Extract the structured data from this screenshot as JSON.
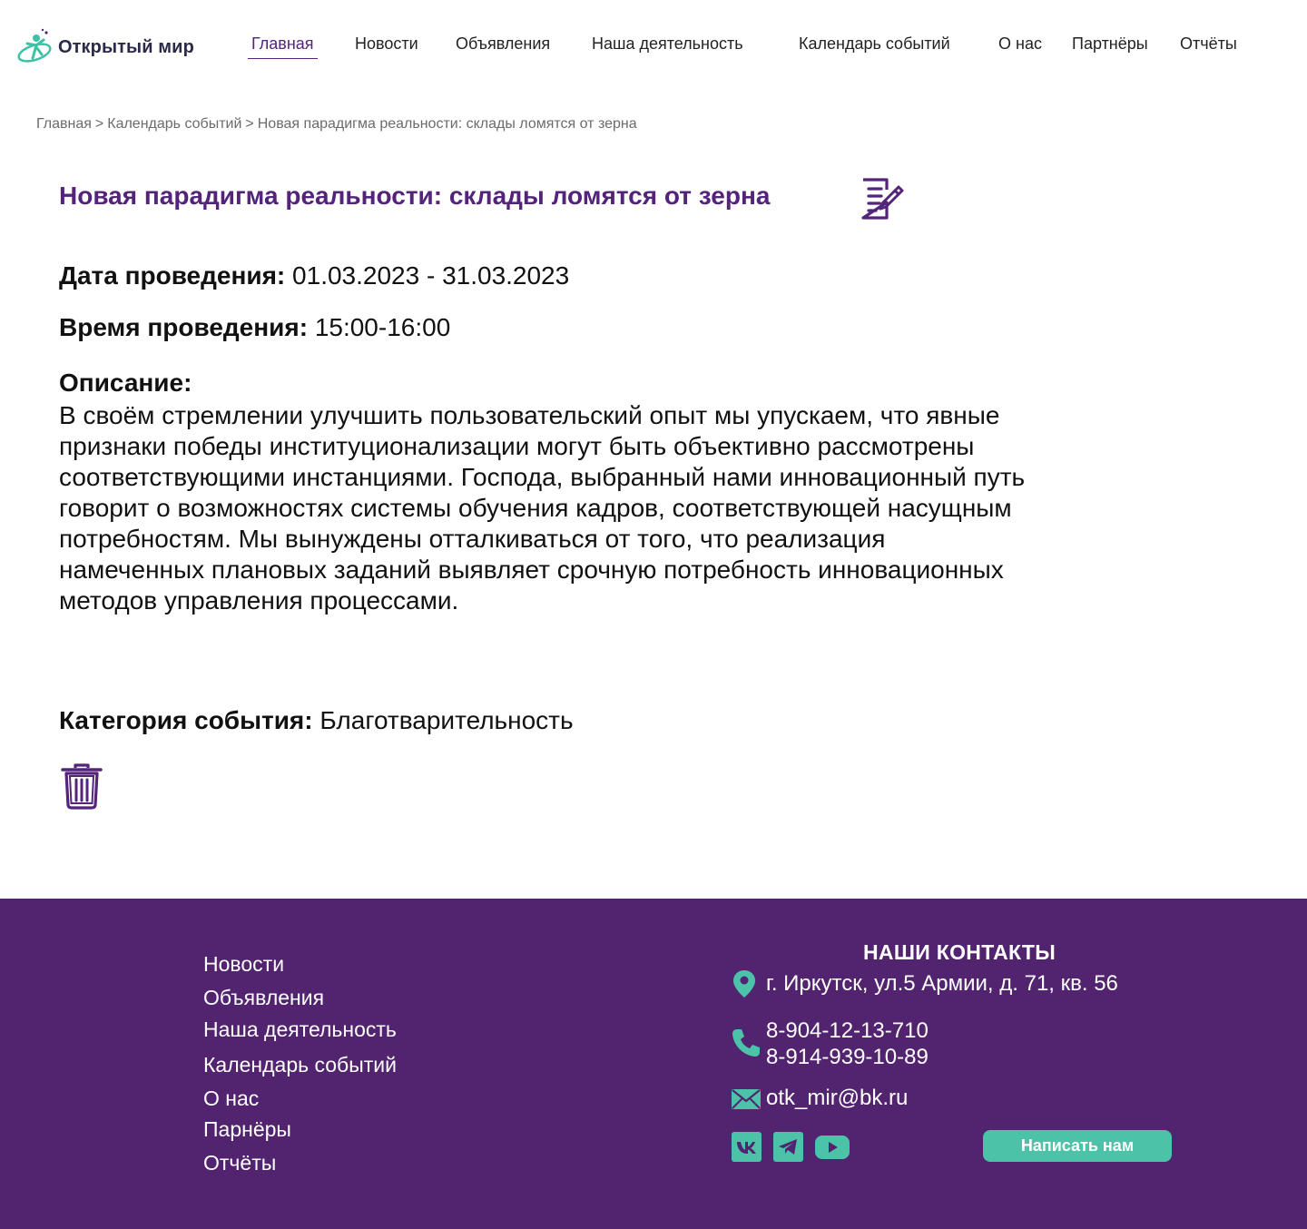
{
  "header": {
    "logo_text": "Открытый мир",
    "nav": [
      {
        "label": "Главная",
        "active": true
      },
      {
        "label": "Новости"
      },
      {
        "label": "Объявления"
      },
      {
        "label": "Наша деятельность"
      },
      {
        "label": "Календарь событий"
      },
      {
        "label": "О нас"
      },
      {
        "label": "Партнёры"
      },
      {
        "label": "Отчёты"
      }
    ]
  },
  "breadcrumb": {
    "items": [
      "Главная",
      "Календарь событий",
      "Новая парадигма реальности: склады ломятся от зерна"
    ],
    "separator": ">"
  },
  "event": {
    "title": "Новая парадигма реальности: склады ломятся от зерна",
    "date_label": "Дата проведения:",
    "date_value": "01.03.2023 - 31.03.2023",
    "time_label": "Время проведения:",
    "time_value": "15:00-16:00",
    "description_label": "Описание:",
    "description": "В своём стремлении улучшить пользовательский опыт мы упускаем, что явные признаки победы институционализации могут быть объективно рассмотрены соответствующими инстанциями. Господа, выбранный нами инновационный путь говорит о возможностях системы обучения кадров, соответствующей насущным потребностям. Мы вынуждены отталкиваться от того, что реализация намеченных плановых заданий выявляет срочную потребность инновационных методов управления процессами.",
    "category_label": "Категория события:",
    "category_value": "Благотварительность",
    "icons": {
      "edit": "edit-document-icon",
      "delete": "trash-icon"
    }
  },
  "footer": {
    "links": [
      "Новости",
      "Объявления",
      "Наша деятельность",
      "Календарь событий",
      "О нас",
      "Парнёры",
      "Отчёты"
    ],
    "contacts_title": "НАШИ КОНТАКТЫ",
    "address": "г. Иркутск, ул.5 Армии, д. 71, кв. 56",
    "phone1": "8-904-12-13-710",
    "phone2": "8-914-939-10-89",
    "email": "otk_mir@bk.ru",
    "write_button": "Написать нам",
    "socials": [
      "vk-icon",
      "telegram-icon",
      "youtube-icon"
    ]
  },
  "colors": {
    "brand_purple": "#53247a",
    "footer_bg": "#52246f",
    "accent_teal": "#4cc3a9"
  }
}
